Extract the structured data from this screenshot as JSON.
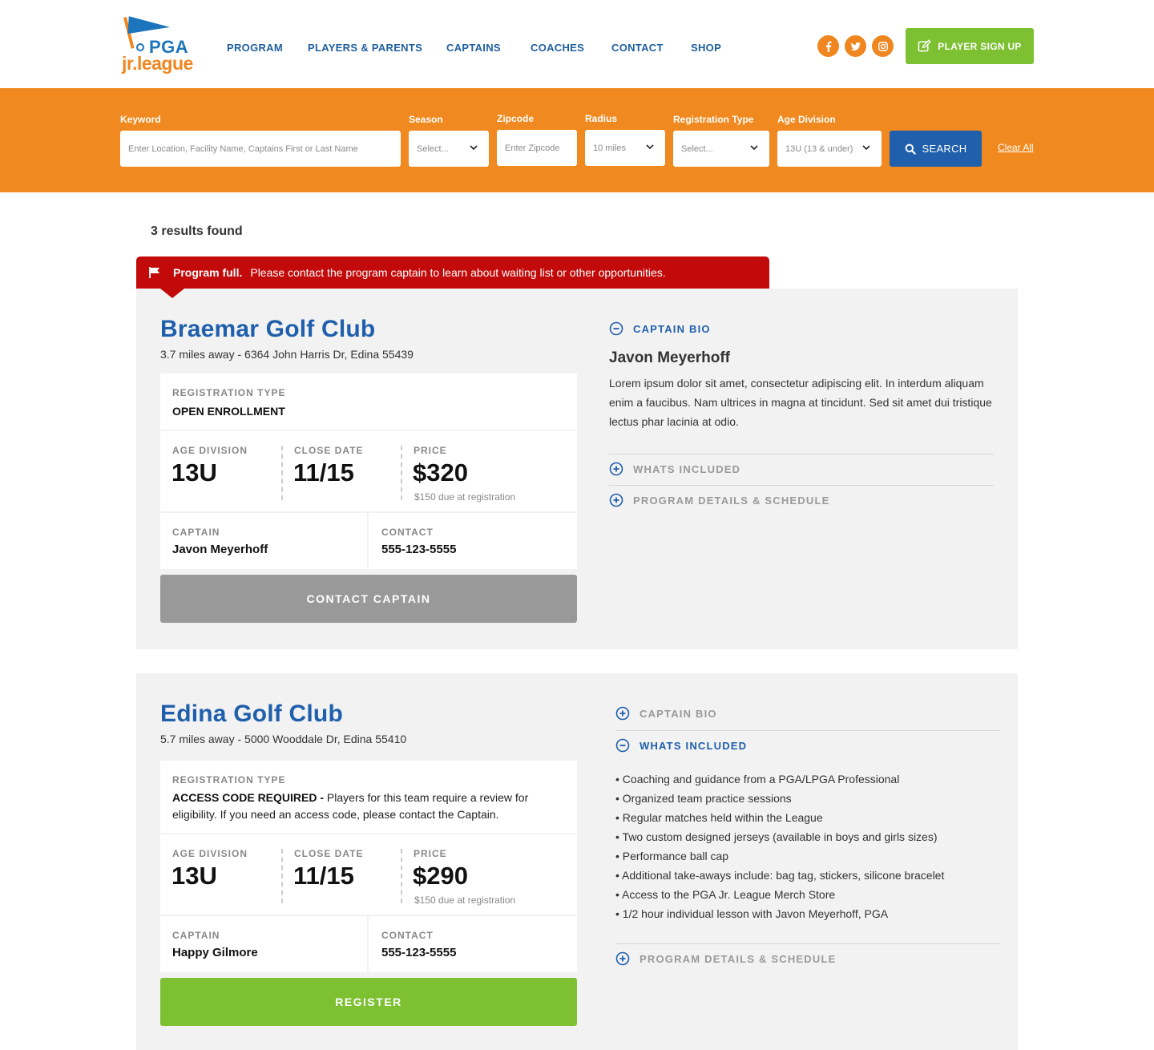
{
  "header": {
    "logo": {
      "pga": "PGA",
      "jr": "jr.league"
    },
    "nav": [
      "PROGRAM",
      "PLAYERS & PARENTS",
      "CAPTAINS",
      "COACHES",
      "CONTACT",
      "SHOP"
    ],
    "social": [
      "facebook-icon",
      "twitter-icon",
      "instagram-icon"
    ],
    "signup_label": "PLAYER SIGN UP"
  },
  "search": {
    "keyword_label": "Keyword",
    "keyword_placeholder": "Enter Location, Facility Name, Captains First or Last Name",
    "season_label": "Season",
    "season_value": "Select...",
    "zipcode_label": "Zipcode",
    "zipcode_placeholder": "Enter Zipcode",
    "radius_label": "Radius",
    "radius_value": "10 miles",
    "regtype_label": "Registration Type",
    "regtype_value": "Select...",
    "agediv_label": "Age Division",
    "agediv_value": "13U (13 & under)",
    "search_label": "SEARCH",
    "clear_label": "Clear All"
  },
  "results": {
    "count_text": "3 results found",
    "notice_bold": "Program full.",
    "notice_text": "Please contact the program captain to learn about waiting list or other opportunities.",
    "cards": [
      {
        "name": "Braemar Golf Club",
        "address": "3.7 miles away - 6364 John Harris Dr, Edina 55439",
        "reg_type_label": "REGISTRATION TYPE",
        "reg_type_value": "OPEN ENROLLMENT",
        "age_label": "AGE DIVISION",
        "age_value": "13U",
        "close_label": "CLOSE DATE",
        "close_value": "11/15",
        "price_label": "PRICE",
        "price_value": "$320",
        "price_note": "$150 due at registration",
        "captain_label": "CAPTAIN",
        "captain_value": "Javon Meyerhoff",
        "contact_label": "CONTACT",
        "contact_value": "555-123-5555",
        "button": "CONTACT CAPTAIN",
        "acc_bio": "CAPTAIN BIO",
        "bio_name": "Javon Meyerhoff",
        "bio_text": "Lorem ipsum dolor sit amet, consectetur adipiscing elit. In interdum aliquam enim a faucibus. Nam ultrices in magna at tincidunt. Sed sit amet dui tristique lectus phar lacinia at odio.",
        "acc_included": "WHATS INCLUDED",
        "acc_details": "PROGRAM DETAILS & SCHEDULE"
      },
      {
        "name": "Edina Golf Club",
        "address": "5.7 miles away - 5000 Wooddale Dr, Edina 55410",
        "reg_type_label": "REGISTRATION TYPE",
        "reg_type_bold": "ACCESS CODE REQUIRED -",
        "reg_type_desc": "Players for this team require a review for eligibility. If you need an access code, please contact the Captain.",
        "age_label": "AGE DIVISION",
        "age_value": "13U",
        "close_label": "CLOSE DATE",
        "close_value": "11/15",
        "price_label": "PRICE",
        "price_value": "$290",
        "price_note": "$150 due at registration",
        "captain_label": "CAPTAIN",
        "captain_value": "Happy Gilmore",
        "contact_label": "CONTACT",
        "contact_value": "555-123-5555",
        "button": "REGISTER",
        "acc_bio": "CAPTAIN BIO",
        "acc_included": "WHATS INCLUDED",
        "included_items": [
          "Coaching and guidance from a PGA/LPGA Professional",
          "Organized team practice sessions",
          "Regular matches held within the League",
          "Two custom designed jerseys (available in boys and girls sizes)",
          "Performance ball cap",
          "Additional take-aways include: bag tag, stickers, silicone bracelet",
          "Access to the PGA Jr. League Merch Store",
          "1/2 hour individual lesson with Javon Meyerhoff, PGA"
        ],
        "acc_details": "PROGRAM DETAILS & SCHEDULE"
      }
    ]
  },
  "colors": {
    "orange": "#f0891f",
    "blue": "#1f5fab",
    "green": "#7dc032",
    "red": "#c20a0a",
    "gray_button": "#999999"
  }
}
